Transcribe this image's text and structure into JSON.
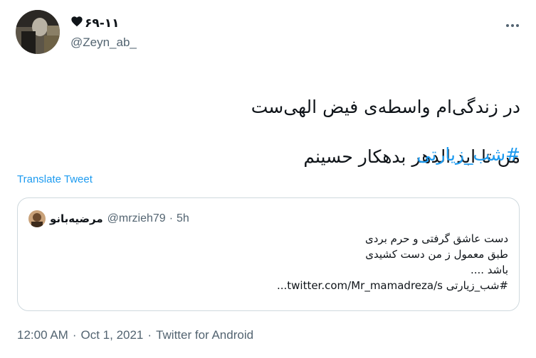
{
  "author": {
    "display_name": "۶۹-۱۱",
    "handle": "@Zeyn_ab_"
  },
  "tweet": {
    "text_line1": "در زندگی‌ام واسطه‌ی فیض الهی‌ست",
    "text_line2": "من تا ابد الدهر بدهکار حسینم",
    "hashtag": "#شب_زیارتی",
    "translate_label": "Translate Tweet"
  },
  "quote": {
    "display_name": "مرضیه‌بانو",
    "handle": "@mrzieh79",
    "separator": "·",
    "time": "5h",
    "lines": [
      "دست عاشق گرفتی و حرم بردی",
      "طبق معمول ز من دست کشیدی",
      "باشد ....",
      "#شب_زیارتی twitter.com/Mr_mamadreza/s..."
    ]
  },
  "footer": {
    "time": "12:00 AM",
    "separator": "·",
    "date": "Oct 1, 2021",
    "source": "Twitter for Android"
  },
  "colors": {
    "link": "#1d9bf0",
    "secondary_text": "#536471",
    "border": "#cfd9de"
  }
}
